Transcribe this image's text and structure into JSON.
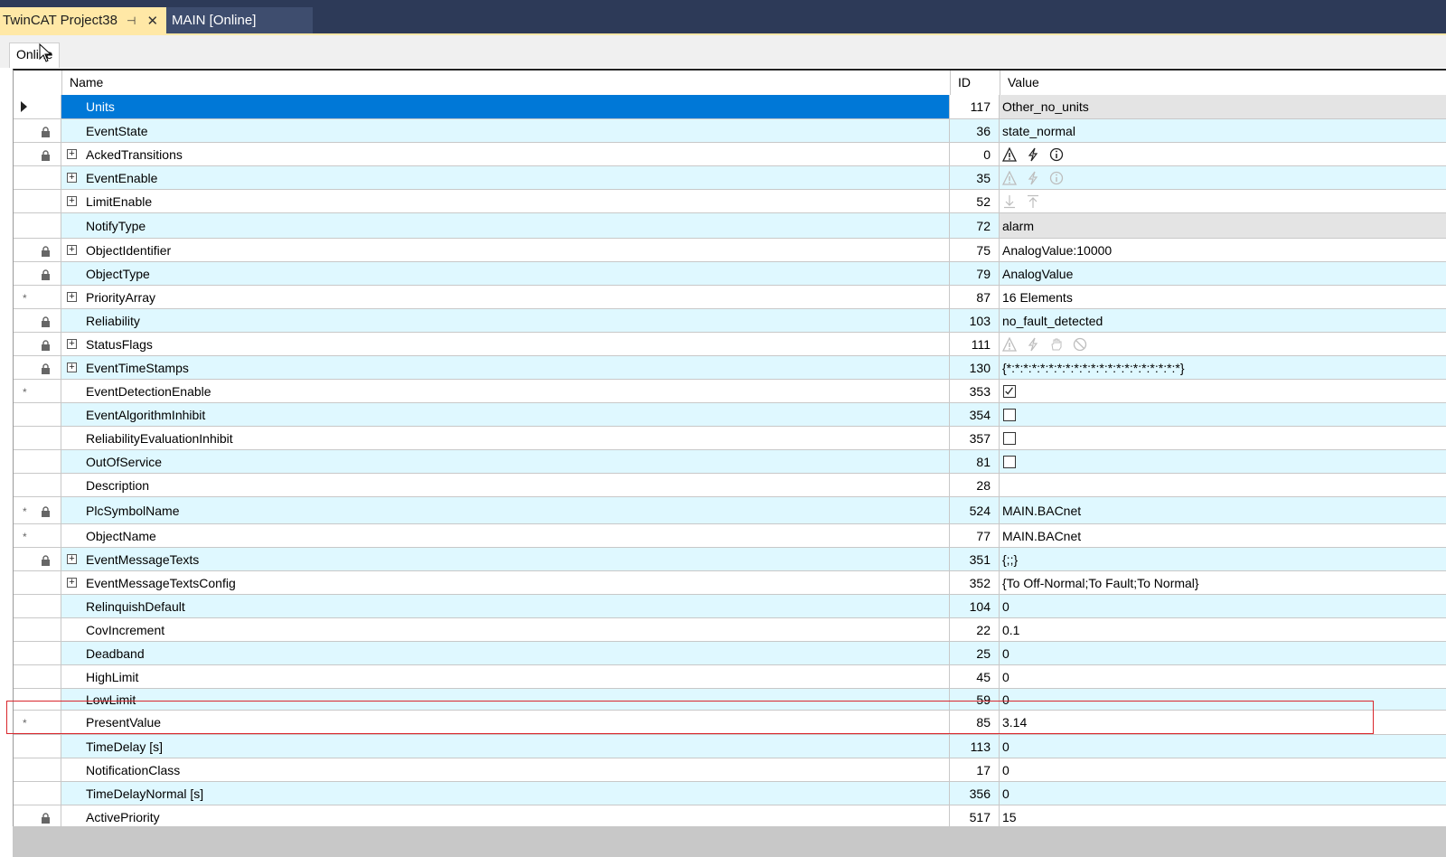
{
  "tabs": [
    {
      "label": "TwinCAT Project38",
      "active": true
    },
    {
      "label": "MAIN [Online]",
      "active": false
    }
  ],
  "inner_tab": {
    "label": "Online"
  },
  "columns": {
    "name": "Name",
    "id": "ID",
    "value": "Value"
  },
  "colors": {
    "selected": "#0078d7",
    "row_alt": "#dff8ff",
    "highlight_box": "#d9262c",
    "tab_active": "#ffe8a6",
    "tabbar": "#2d3a58"
  },
  "rows": [
    {
      "name": "Units",
      "id": "117",
      "value": "Other_no_units",
      "selected": true,
      "shade": "grey",
      "star": false,
      "lock": false,
      "expand": false,
      "value_kind": "text"
    },
    {
      "name": "EventState",
      "id": "36",
      "value": "state_normal",
      "shade": "cyan",
      "star": false,
      "lock": true,
      "expand": false,
      "value_kind": "text"
    },
    {
      "name": "AckedTransitions",
      "id": "0",
      "value": "",
      "shade": "white",
      "star": false,
      "lock": true,
      "expand": true,
      "value_kind": "icons",
      "icons": [
        "warning-icon",
        "fault-icon",
        "info-icon"
      ],
      "icons_faded": false
    },
    {
      "name": "EventEnable",
      "id": "35",
      "value": "",
      "shade": "cyan",
      "star": false,
      "lock": false,
      "expand": true,
      "value_kind": "icons",
      "icons": [
        "warning-icon",
        "fault-icon",
        "info-icon"
      ],
      "icons_faded": true
    },
    {
      "name": "LimitEnable",
      "id": "52",
      "value": "",
      "shade": "white",
      "star": false,
      "lock": false,
      "expand": true,
      "value_kind": "icons",
      "icons": [
        "low-limit-icon",
        "high-limit-icon"
      ],
      "icons_faded": true
    },
    {
      "name": "NotifyType",
      "id": "72",
      "value": "alarm",
      "shade": "grey",
      "star": false,
      "lock": false,
      "expand": false,
      "value_kind": "text"
    },
    {
      "name": "ObjectIdentifier",
      "id": "75",
      "value": "AnalogValue:10000",
      "shade": "white",
      "star": false,
      "lock": true,
      "expand": true,
      "value_kind": "text"
    },
    {
      "name": "ObjectType",
      "id": "79",
      "value": "AnalogValue",
      "shade": "cyan",
      "star": false,
      "lock": true,
      "expand": false,
      "value_kind": "text"
    },
    {
      "name": "PriorityArray",
      "id": "87",
      "value": "16 Elements",
      "shade": "white",
      "star": true,
      "lock": false,
      "expand": true,
      "value_kind": "text"
    },
    {
      "name": "Reliability",
      "id": "103",
      "value": "no_fault_detected",
      "shade": "cyan",
      "star": false,
      "lock": true,
      "expand": false,
      "value_kind": "text"
    },
    {
      "name": "StatusFlags",
      "id": "111",
      "value": "",
      "shade": "white",
      "star": false,
      "lock": true,
      "expand": true,
      "value_kind": "icons",
      "icons": [
        "warning-icon",
        "fault-icon",
        "hand-icon",
        "blocked-icon"
      ],
      "icons_faded": true
    },
    {
      "name": "EventTimeStamps",
      "id": "130",
      "value": "{*:*:*:*:*:*:*:*:*:*:*:*:*:*:*:*:*:*:*:*:*}",
      "shade": "cyan",
      "star": false,
      "lock": true,
      "expand": true,
      "value_kind": "text"
    },
    {
      "name": "EventDetectionEnable",
      "id": "353",
      "value": "",
      "shade": "white",
      "star": true,
      "lock": false,
      "expand": false,
      "value_kind": "checkbox",
      "checked": true
    },
    {
      "name": "EventAlgorithmInhibit",
      "id": "354",
      "value": "",
      "shade": "cyan",
      "star": false,
      "lock": false,
      "expand": false,
      "value_kind": "checkbox",
      "checked": false
    },
    {
      "name": "ReliabilityEvaluationInhibit",
      "id": "357",
      "value": "",
      "shade": "white",
      "star": false,
      "lock": false,
      "expand": false,
      "value_kind": "checkbox",
      "checked": false
    },
    {
      "name": "OutOfService",
      "id": "81",
      "value": "",
      "shade": "cyan",
      "star": false,
      "lock": false,
      "expand": false,
      "value_kind": "checkbox",
      "checked": false
    },
    {
      "name": "Description",
      "id": "28",
      "value": "",
      "shade": "white",
      "star": false,
      "lock": false,
      "expand": false,
      "value_kind": "text"
    },
    {
      "name": "PlcSymbolName",
      "id": "524",
      "value": "MAIN.BACnet",
      "shade": "cyan",
      "star": true,
      "lock": true,
      "expand": false,
      "value_kind": "text"
    },
    {
      "name": "ObjectName",
      "id": "77",
      "value": "MAIN.BACnet",
      "shade": "white",
      "star": true,
      "lock": false,
      "expand": false,
      "value_kind": "text"
    },
    {
      "name": "EventMessageTexts",
      "id": "351",
      "value": "{;;}",
      "shade": "cyan",
      "star": false,
      "lock": true,
      "expand": true,
      "value_kind": "text"
    },
    {
      "name": "EventMessageTextsConfig",
      "id": "352",
      "value": "{To Off-Normal;To Fault;To Normal}",
      "shade": "white",
      "star": false,
      "lock": false,
      "expand": true,
      "value_kind": "text"
    },
    {
      "name": "RelinquishDefault",
      "id": "104",
      "value": "0",
      "shade": "cyan",
      "star": false,
      "lock": false,
      "expand": false,
      "value_kind": "text"
    },
    {
      "name": "CovIncrement",
      "id": "22",
      "value": "0.1",
      "shade": "white",
      "star": false,
      "lock": false,
      "expand": false,
      "value_kind": "text"
    },
    {
      "name": "Deadband",
      "id": "25",
      "value": "0",
      "shade": "cyan",
      "star": false,
      "lock": false,
      "expand": false,
      "value_kind": "text"
    },
    {
      "name": "HighLimit",
      "id": "45",
      "value": "0",
      "shade": "white",
      "star": false,
      "lock": false,
      "expand": false,
      "value_kind": "text"
    },
    {
      "name": "LowLimit",
      "id": "59",
      "value": "0",
      "shade": "cyan",
      "star": false,
      "lock": false,
      "expand": false,
      "value_kind": "text"
    },
    {
      "name": "PresentValue",
      "id": "85",
      "value": "3.14",
      "shade": "white",
      "star": true,
      "lock": false,
      "expand": false,
      "value_kind": "text",
      "highlighted": true
    },
    {
      "name": "TimeDelay [s]",
      "id": "113",
      "value": "0",
      "shade": "cyan",
      "star": false,
      "lock": false,
      "expand": false,
      "value_kind": "text"
    },
    {
      "name": "NotificationClass",
      "id": "17",
      "value": "0",
      "shade": "white",
      "star": false,
      "lock": false,
      "expand": false,
      "value_kind": "text"
    },
    {
      "name": "TimeDelayNormal [s]",
      "id": "356",
      "value": "0",
      "shade": "cyan",
      "star": false,
      "lock": false,
      "expand": false,
      "value_kind": "text"
    },
    {
      "name": "ActivePriority",
      "id": "517",
      "value": "15",
      "shade": "white",
      "star": false,
      "lock": true,
      "expand": false,
      "value_kind": "text"
    }
  ]
}
